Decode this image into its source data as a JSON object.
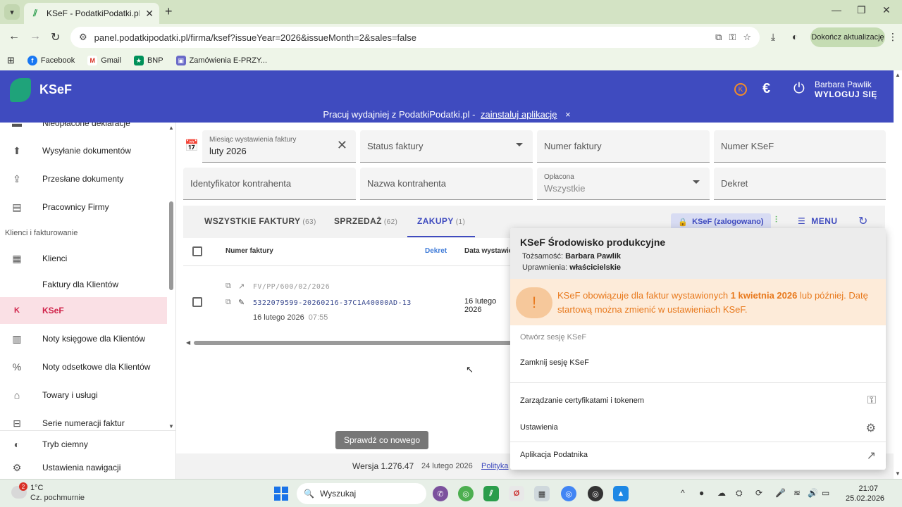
{
  "browser": {
    "tab_title": "KSeF - PodatkiPodatki.pl",
    "url": "panel.podatkipodatki.pl/firma/ksef?issueYear=2026&issueMonth=2&sales=false",
    "update_label": "Dokończ aktualizację",
    "bookmarks": [
      {
        "label": "Facebook",
        "icon": "facebook-icon",
        "color": "#1877f2"
      },
      {
        "label": "Gmail",
        "icon": "gmail-icon",
        "color": "#d93025"
      },
      {
        "label": "BNP",
        "icon": "bnp-icon",
        "color": "#00915a"
      },
      {
        "label": "Zamówienia E-PRZY...",
        "icon": "orders-icon",
        "color": "#6a6ac8"
      }
    ]
  },
  "header": {
    "brand": "KSeF",
    "user_name": "Barbara Pawlik",
    "logout_label": "WYLOGUJ SIĘ",
    "promo_text": "Pracuj wydajniej z PodatkiPodatki.pl -",
    "promo_link": "zainstaluj aplikację",
    "promo_close": "×"
  },
  "sidebar": {
    "section_label": "Klienci i fakturowanie",
    "items": [
      {
        "label": "Nieopłacone deklaracje",
        "icon": "declaration-icon"
      },
      {
        "label": "Wysyłanie dokumentów",
        "icon": "upload-icon"
      },
      {
        "label": "Przesłane dokumenty",
        "icon": "sent-documents-icon"
      },
      {
        "label": "Pracownicy Firmy",
        "icon": "employees-icon"
      },
      {
        "label": "Klienci",
        "icon": "clients-icon"
      },
      {
        "label": "Faktury dla Klientów",
        "icon": ""
      },
      {
        "label": "KSeF",
        "icon": "ksef-icon"
      },
      {
        "label": "Noty księgowe dla Klientów",
        "icon": "accounting-note-icon"
      },
      {
        "label": "Noty odsetkowe dla Klientów",
        "icon": "interest-note-icon"
      },
      {
        "label": "Towary i usługi",
        "icon": "warehouse-icon"
      },
      {
        "label": "Serie numeracji faktur",
        "icon": "numbering-icon"
      }
    ],
    "bottom": [
      {
        "label": "Tryb ciemny",
        "icon": "dark-mode-icon"
      },
      {
        "label": "Ustawienia nawigacji",
        "icon": "gear-icon"
      }
    ]
  },
  "filters": {
    "month_label": "Miesiąc wystawienia faktury",
    "month_value": "luty 2026",
    "status_placeholder": "Status faktury",
    "number_placeholder": "Numer faktury",
    "ksef_number_placeholder": "Numer KSeF",
    "contractor_id_placeholder": "Identyfikator kontrahenta",
    "contractor_name_placeholder": "Nazwa kontrahenta",
    "paid_label": "Opłacona",
    "paid_value": "Wszystkie",
    "dekret_placeholder": "Dekret"
  },
  "tabs": [
    {
      "label": "WSZYSTKIE FAKTURY",
      "count": "(63)"
    },
    {
      "label": "SPRZEDAŻ",
      "count": "(62)"
    },
    {
      "label": "ZAKUPY",
      "count": "(1)"
    }
  ],
  "toolbar": {
    "ksef_status": "KSeF (zalogowano)",
    "menu_label": "MENU"
  },
  "table": {
    "col_number": "Numer faktury",
    "col_dekret": "Dekret",
    "col_date": "Data wystawie",
    "rows": [
      {
        "invoice_number": "FV/PP/600/02/2026",
        "ksef_number": "5322079599-20260216-37C1A40000AD-13",
        "received_date": "16 lutego 2026",
        "received_time": "07:55",
        "issue_date": "16 lutego 2026"
      }
    ]
  },
  "check_new_label": "Sprawdź co nowego",
  "footer": {
    "version": "Wersja 1.276.47",
    "date": "24 lutego 2026",
    "policy": "Polityka"
  },
  "panel": {
    "title": "KSeF Środowisko produkcyjne",
    "identity_label": "Tożsamość:",
    "identity_value": "Barbara Pawlik",
    "permissions_label": "Uprawnienia:",
    "permissions_value": "właścicielskie",
    "warning_pre": "KSeF obowiązuje dla faktur wystawionych",
    "warning_date": "1 kwietnia 2026",
    "warning_post": "lub później. Datę startową można zmienić w ustawieniach KSeF.",
    "open_session": "Otwórz sesję KSeF",
    "close_session": "Zamknij sesję KSeF",
    "certificates": "Zarządzanie certyfikatami i tokenem",
    "settings": "Ustawienia",
    "taxpayer_app": "Aplikacja Podatnika"
  },
  "taskbar": {
    "temperature": "1°C",
    "weather": "Cz. pochmurnie",
    "weather_badge": "2",
    "search_placeholder": "Wyszukaj",
    "time": "21:07",
    "date": "25.02.2026"
  },
  "colors": {
    "header_blue": "#3f4bbf",
    "active_pink": "#d0234a",
    "warning_orange": "#e8791d"
  }
}
